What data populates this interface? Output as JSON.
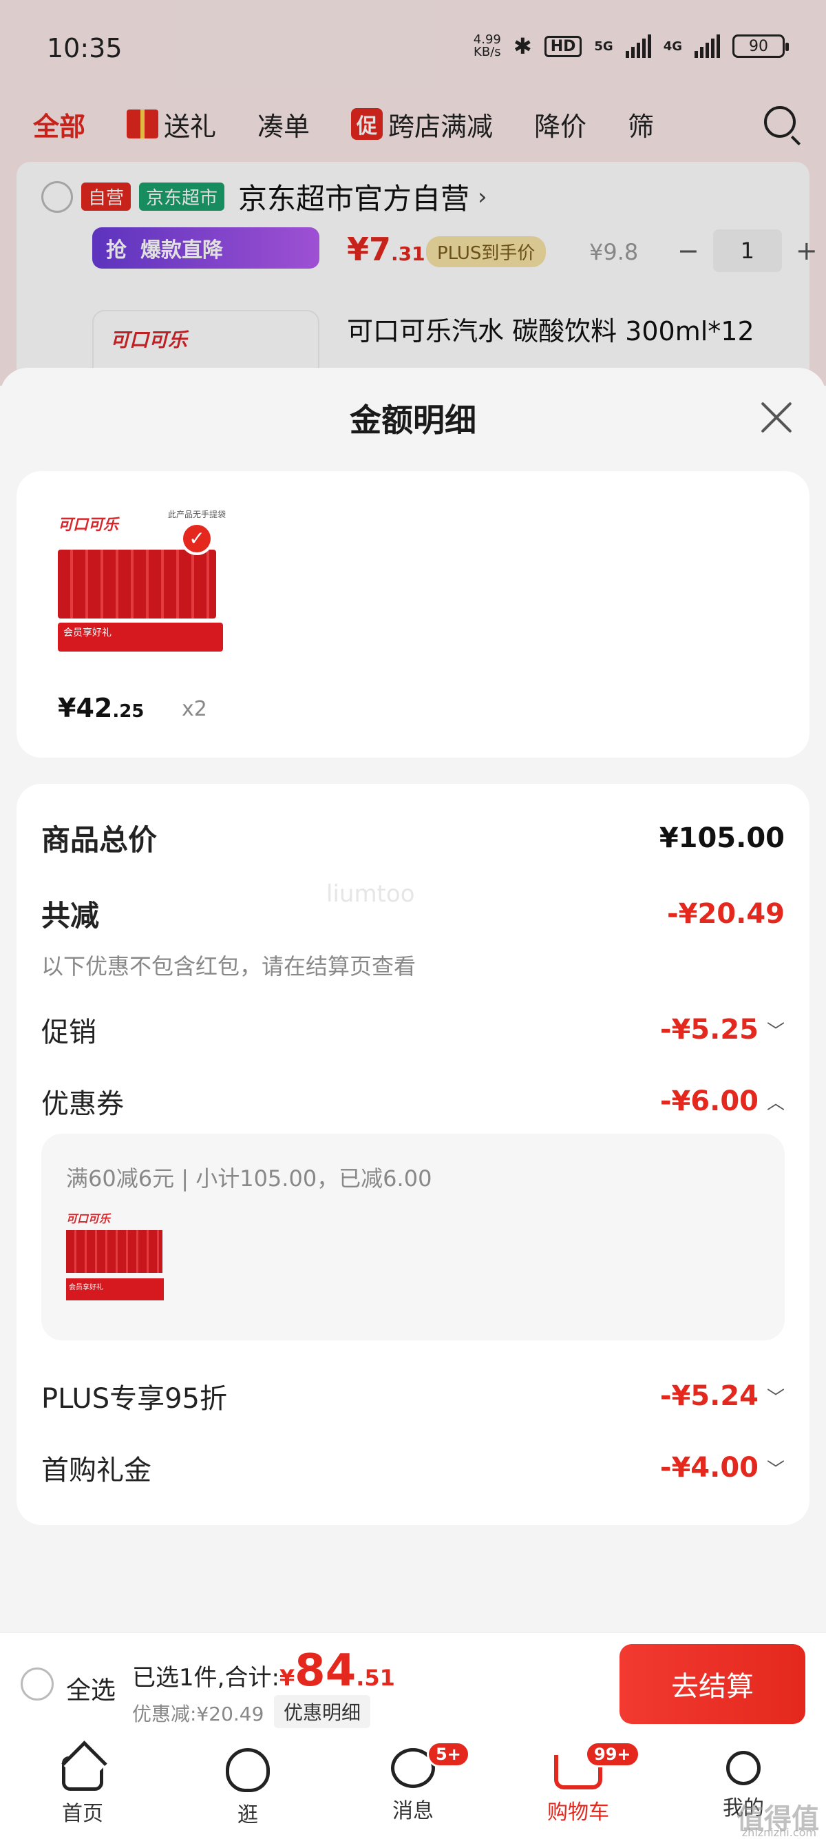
{
  "status_bar": {
    "time": "10:35",
    "speed": "4.99",
    "speed_unit": "KB/s",
    "bluetooth": "bluetooth-icon",
    "hd": "HD",
    "net1": "5G",
    "net2": "4G",
    "battery": "90"
  },
  "filter_tabs": [
    "全部",
    "送礼",
    "凑单",
    "促",
    "跨店满减",
    "降价",
    "筛"
  ],
  "store": {
    "tag_self": "自营",
    "tag_market": "京东超市",
    "name": "京东超市官方自营",
    "arrow": "›"
  },
  "item1": {
    "banner_left": "抢",
    "banner_text": "爆款直降",
    "price_int": "¥7",
    "price_dec": ".31",
    "plus_label": "PLUS到手价",
    "orig_price": "¥9.8",
    "minus": "−",
    "qty": "1",
    "plus": "+"
  },
  "item2": {
    "logo": "可口可乐",
    "title": "可口可乐汽水 碳酸饮料 300ml*12"
  },
  "sheet": {
    "title": "金额明细",
    "product": {
      "img_top": "此产品无手提袋",
      "img_logo": "可口可乐",
      "img_banner": "会员享好礼",
      "price_int": "¥42",
      "price_dec": ".25",
      "qty": "x2"
    },
    "watermark": "liumtoo",
    "rows": {
      "total_label": "商品总价",
      "total_value": "¥105.00",
      "reduce_label": "共减",
      "reduce_value": "-¥20.49",
      "note": "以下优惠不包含红包，请在结算页查看",
      "promo_label": "促销",
      "promo_value": "-¥5.25",
      "coupon_label": "优惠券",
      "coupon_value": "-¥6.00",
      "plus_label": "PLUS专享95折",
      "plus_value": "-¥5.24",
      "first_label": "首购礼金",
      "first_value": "-¥4.00"
    },
    "coupon_box": {
      "text": "满60减6元 | 小计105.00，已减6.00",
      "img_logo": "可口可乐",
      "img_banner": "会员享好礼"
    }
  },
  "checkout": {
    "select_all": "全选",
    "selected_text": "已选1件,合计:",
    "currency": "¥",
    "total_int": "84",
    "total_dec": ".51",
    "discount": "优惠减:¥20.49",
    "detail_button": "优惠明细",
    "checkout_button": "去结算"
  },
  "nav": [
    {
      "label": "首页",
      "icon": "home-icon"
    },
    {
      "label": "逛",
      "icon": "discover-icon"
    },
    {
      "label": "消息",
      "icon": "message-icon",
      "badge": "5+"
    },
    {
      "label": "购物车",
      "icon": "cart-icon",
      "badge": "99+"
    },
    {
      "label": "我的",
      "icon": "user-icon"
    }
  ],
  "corner": {
    "watermark": "值得值",
    "url": "zhiznizhi.com"
  },
  "colors": {
    "accent": "#e4281e",
    "market_green": "#1aa06d"
  }
}
